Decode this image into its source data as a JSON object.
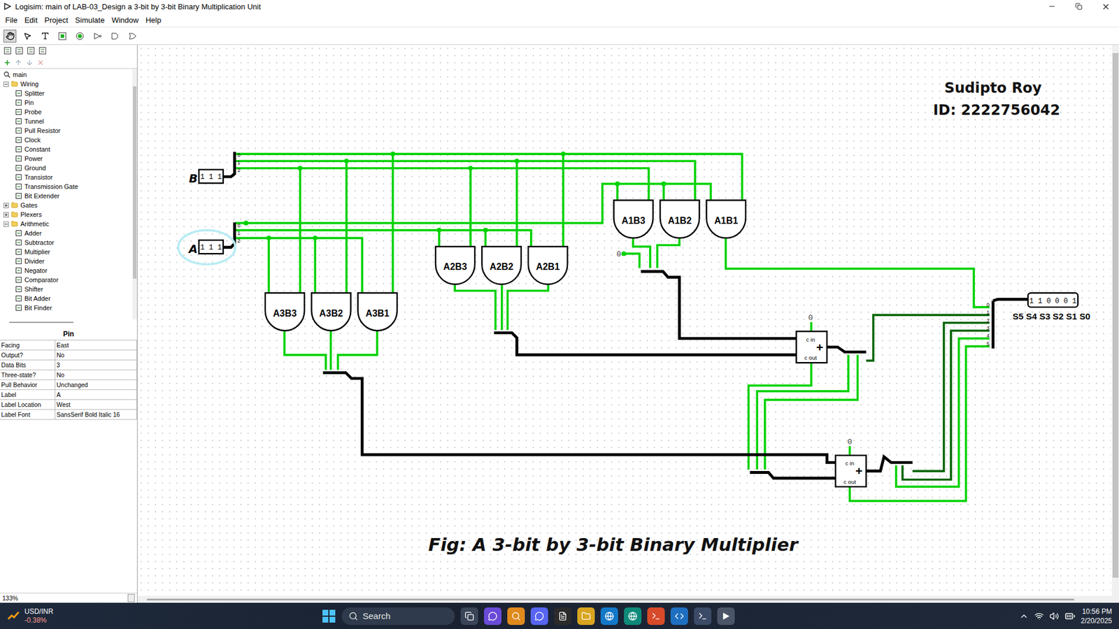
{
  "window": {
    "title": "Logisim: main of LAB-03_Design a 3-bit by 3-bit Binary Multiplication Unit"
  },
  "menu": [
    "File",
    "Edit",
    "Project",
    "Simulate",
    "Window",
    "Help"
  ],
  "tree": [
    {
      "label": "main",
      "kind": "circuit"
    },
    {
      "label": "Wiring",
      "kind": "folder",
      "expanded": true,
      "items": [
        {
          "label": "Splitter",
          "kind": "tool"
        },
        {
          "label": "Pin",
          "kind": "tool"
        },
        {
          "label": "Probe",
          "kind": "tool"
        },
        {
          "label": "Tunnel",
          "kind": "tool"
        },
        {
          "label": "Pull Resistor",
          "kind": "tool"
        },
        {
          "label": "Clock",
          "kind": "tool"
        },
        {
          "label": "Constant",
          "kind": "tool"
        },
        {
          "label": "Power",
          "kind": "tool"
        },
        {
          "label": "Ground",
          "kind": "tool"
        },
        {
          "label": "Transistor",
          "kind": "tool"
        },
        {
          "label": "Transmission Gate",
          "kind": "tool"
        },
        {
          "label": "Bit Extender",
          "kind": "tool"
        }
      ]
    },
    {
      "label": "Gates",
      "kind": "folder",
      "expanded": false,
      "items": []
    },
    {
      "label": "Plexers",
      "kind": "folder",
      "expanded": false,
      "items": []
    },
    {
      "label": "Arithmetic",
      "kind": "folder",
      "expanded": true,
      "items": [
        {
          "label": "Adder",
          "kind": "tool"
        },
        {
          "label": "Subtractor",
          "kind": "tool"
        },
        {
          "label": "Multiplier",
          "kind": "tool"
        },
        {
          "label": "Divider",
          "kind": "tool"
        },
        {
          "label": "Negator",
          "kind": "tool"
        },
        {
          "label": "Comparator",
          "kind": "tool"
        },
        {
          "label": "Shifter",
          "kind": "tool"
        },
        {
          "label": "Bit Adder",
          "kind": "tool"
        },
        {
          "label": "Bit Finder",
          "kind": "tool"
        }
      ]
    }
  ],
  "attributes": {
    "title": "Pin",
    "rows": [
      {
        "name": "Facing",
        "value": "East"
      },
      {
        "name": "Output?",
        "value": "No"
      },
      {
        "name": "Data Bits",
        "value": "3"
      },
      {
        "name": "Three-state?",
        "value": "No"
      },
      {
        "name": "Pull Behavior",
        "value": "Unchanged"
      },
      {
        "name": "Label",
        "value": "A"
      },
      {
        "name": "Label Location",
        "value": "West"
      },
      {
        "name": "Label Font",
        "value": "SansSerif Bold Italic 16"
      }
    ]
  },
  "zoom": "133%",
  "circuit": {
    "inputs": [
      {
        "label": "B",
        "value": "1 1 1",
        "selected": false
      },
      {
        "label": "A",
        "value": "1 1 1",
        "selected": true
      }
    ],
    "input_bits": [
      "0",
      "1",
      "2"
    ],
    "gates": [
      "A3B3",
      "A3B2",
      "A3B1",
      "A2B3",
      "A2B2",
      "A2B1",
      "A1B3",
      "A1B2",
      "A1B1"
    ],
    "constants": [
      "0",
      "0",
      "0"
    ],
    "adders": [
      {
        "carry_in": "c in",
        "carry_out": "c out",
        "symbol": "+"
      },
      {
        "carry_in": "c in",
        "carry_out": "c out",
        "symbol": "+"
      }
    ],
    "output": {
      "value": "1 1 0 0 0 1",
      "label": "S5 S4 S3 S2 S1 S0",
      "bits": [
        "0",
        "1",
        "2",
        "3",
        "4",
        "5"
      ]
    },
    "author": {
      "name": "Sudipto Roy",
      "id": "ID: 2222756042"
    },
    "caption": "Fig: A 3-bit by 3-bit Binary Multiplier"
  },
  "taskbar": {
    "ticker": {
      "name": "USD/INR",
      "change": "-0.38%"
    },
    "search": {
      "placeholder": "Search"
    },
    "time": "10:56 PM",
    "date": "2/20/2025"
  }
}
